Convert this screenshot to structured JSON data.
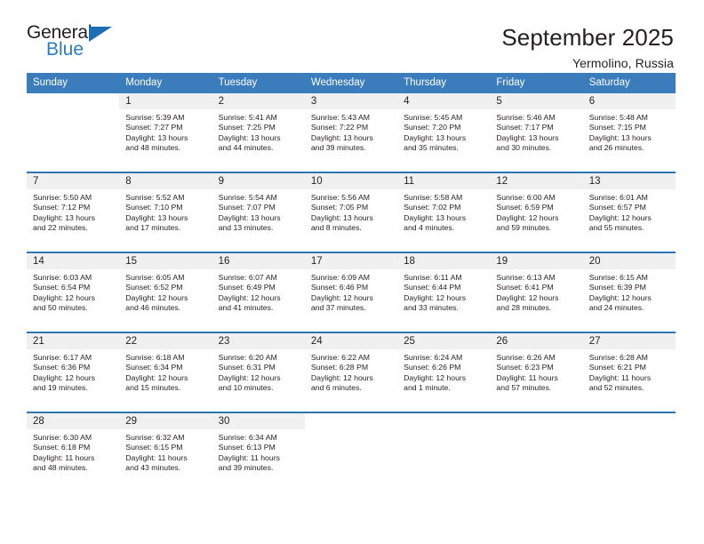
{
  "brand": {
    "name_top": "General",
    "name_bottom": "Blue",
    "accent_color": "#2b7cc0",
    "triangle_color": "#1b6eb3"
  },
  "header": {
    "title": "September 2025",
    "location": "Yermolino, Russia"
  },
  "calendar": {
    "header_bg": "#3b7cbd",
    "row_divider_color": "#2e75b6",
    "daynum_bg": "#f0f0f0",
    "weekday_headers": [
      "Sunday",
      "Monday",
      "Tuesday",
      "Wednesday",
      "Thursday",
      "Friday",
      "Saturday"
    ],
    "weeks": [
      [
        {
          "day": "",
          "info": ""
        },
        {
          "day": "1",
          "info": "Sunrise: 5:39 AM\nSunset: 7:27 PM\nDaylight: 13 hours\nand 48 minutes."
        },
        {
          "day": "2",
          "info": "Sunrise: 5:41 AM\nSunset: 7:25 PM\nDaylight: 13 hours\nand 44 minutes."
        },
        {
          "day": "3",
          "info": "Sunrise: 5:43 AM\nSunset: 7:22 PM\nDaylight: 13 hours\nand 39 minutes."
        },
        {
          "day": "4",
          "info": "Sunrise: 5:45 AM\nSunset: 7:20 PM\nDaylight: 13 hours\nand 35 minutes."
        },
        {
          "day": "5",
          "info": "Sunrise: 5:46 AM\nSunset: 7:17 PM\nDaylight: 13 hours\nand 30 minutes."
        },
        {
          "day": "6",
          "info": "Sunrise: 5:48 AM\nSunset: 7:15 PM\nDaylight: 13 hours\nand 26 minutes."
        }
      ],
      [
        {
          "day": "7",
          "info": "Sunrise: 5:50 AM\nSunset: 7:12 PM\nDaylight: 13 hours\nand 22 minutes."
        },
        {
          "day": "8",
          "info": "Sunrise: 5:52 AM\nSunset: 7:10 PM\nDaylight: 13 hours\nand 17 minutes."
        },
        {
          "day": "9",
          "info": "Sunrise: 5:54 AM\nSunset: 7:07 PM\nDaylight: 13 hours\nand 13 minutes."
        },
        {
          "day": "10",
          "info": "Sunrise: 5:56 AM\nSunset: 7:05 PM\nDaylight: 13 hours\nand 8 minutes."
        },
        {
          "day": "11",
          "info": "Sunrise: 5:58 AM\nSunset: 7:02 PM\nDaylight: 13 hours\nand 4 minutes."
        },
        {
          "day": "12",
          "info": "Sunrise: 6:00 AM\nSunset: 6:59 PM\nDaylight: 12 hours\nand 59 minutes."
        },
        {
          "day": "13",
          "info": "Sunrise: 6:01 AM\nSunset: 6:57 PM\nDaylight: 12 hours\nand 55 minutes."
        }
      ],
      [
        {
          "day": "14",
          "info": "Sunrise: 6:03 AM\nSunset: 6:54 PM\nDaylight: 12 hours\nand 50 minutes."
        },
        {
          "day": "15",
          "info": "Sunrise: 6:05 AM\nSunset: 6:52 PM\nDaylight: 12 hours\nand 46 minutes."
        },
        {
          "day": "16",
          "info": "Sunrise: 6:07 AM\nSunset: 6:49 PM\nDaylight: 12 hours\nand 41 minutes."
        },
        {
          "day": "17",
          "info": "Sunrise: 6:09 AM\nSunset: 6:46 PM\nDaylight: 12 hours\nand 37 minutes."
        },
        {
          "day": "18",
          "info": "Sunrise: 6:11 AM\nSunset: 6:44 PM\nDaylight: 12 hours\nand 33 minutes."
        },
        {
          "day": "19",
          "info": "Sunrise: 6:13 AM\nSunset: 6:41 PM\nDaylight: 12 hours\nand 28 minutes."
        },
        {
          "day": "20",
          "info": "Sunrise: 6:15 AM\nSunset: 6:39 PM\nDaylight: 12 hours\nand 24 minutes."
        }
      ],
      [
        {
          "day": "21",
          "info": "Sunrise: 6:17 AM\nSunset: 6:36 PM\nDaylight: 12 hours\nand 19 minutes."
        },
        {
          "day": "22",
          "info": "Sunrise: 6:18 AM\nSunset: 6:34 PM\nDaylight: 12 hours\nand 15 minutes."
        },
        {
          "day": "23",
          "info": "Sunrise: 6:20 AM\nSunset: 6:31 PM\nDaylight: 12 hours\nand 10 minutes."
        },
        {
          "day": "24",
          "info": "Sunrise: 6:22 AM\nSunset: 6:28 PM\nDaylight: 12 hours\nand 6 minutes."
        },
        {
          "day": "25",
          "info": "Sunrise: 6:24 AM\nSunset: 6:26 PM\nDaylight: 12 hours\nand 1 minute."
        },
        {
          "day": "26",
          "info": "Sunrise: 6:26 AM\nSunset: 6:23 PM\nDaylight: 11 hours\nand 57 minutes."
        },
        {
          "day": "27",
          "info": "Sunrise: 6:28 AM\nSunset: 6:21 PM\nDaylight: 11 hours\nand 52 minutes."
        }
      ],
      [
        {
          "day": "28",
          "info": "Sunrise: 6:30 AM\nSunset: 6:18 PM\nDaylight: 11 hours\nand 48 minutes."
        },
        {
          "day": "29",
          "info": "Sunrise: 6:32 AM\nSunset: 6:15 PM\nDaylight: 11 hours\nand 43 minutes."
        },
        {
          "day": "30",
          "info": "Sunrise: 6:34 AM\nSunset: 6:13 PM\nDaylight: 11 hours\nand 39 minutes."
        },
        {
          "day": "",
          "info": ""
        },
        {
          "day": "",
          "info": ""
        },
        {
          "day": "",
          "info": ""
        },
        {
          "day": "",
          "info": ""
        }
      ]
    ]
  }
}
